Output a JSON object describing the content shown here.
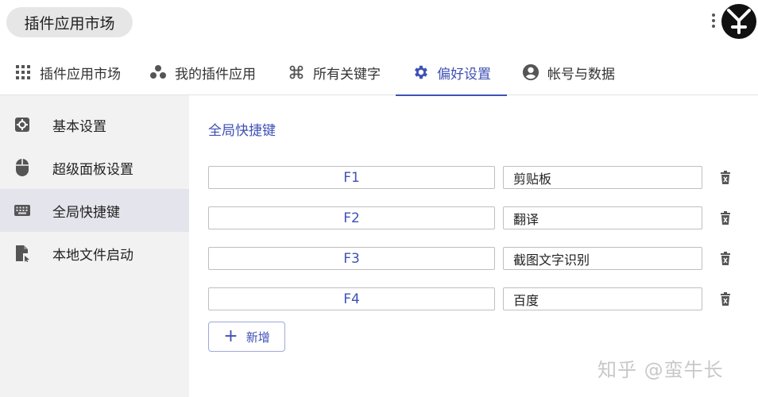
{
  "app": {
    "title": "插件应用市场"
  },
  "tabs": [
    {
      "label": "插件应用市场",
      "icon": "grid-icon"
    },
    {
      "label": "我的插件应用",
      "icon": "bubbles-icon"
    },
    {
      "label": "所有关键字",
      "icon": "command-icon"
    },
    {
      "label": "偏好设置",
      "icon": "gear-icon",
      "active": true
    },
    {
      "label": "帐号与数据",
      "icon": "account-circle-icon"
    }
  ],
  "sidebar": {
    "items": [
      {
        "label": "基本设置",
        "icon": "settings-box-icon"
      },
      {
        "label": "超级面板设置",
        "icon": "mouse-icon"
      },
      {
        "label": "全局快捷键",
        "icon": "keyboard-icon",
        "active": true
      },
      {
        "label": "本地文件启动",
        "icon": "file-launch-icon"
      }
    ]
  },
  "main": {
    "section_title": "全局快捷键",
    "shortcuts": [
      {
        "key": "F1",
        "action": "剪贴板"
      },
      {
        "key": "F2",
        "action": "翻译"
      },
      {
        "key": "F3",
        "action": "截图文字识别"
      },
      {
        "key": "F4",
        "action": "百度"
      }
    ],
    "add_label": "新增"
  },
  "watermark": "知乎 @蛮牛长",
  "colors": {
    "accent": "#3f51b5",
    "sidebar_bg": "#f2f2f2",
    "sidebar_active": "#e4e4ec"
  }
}
